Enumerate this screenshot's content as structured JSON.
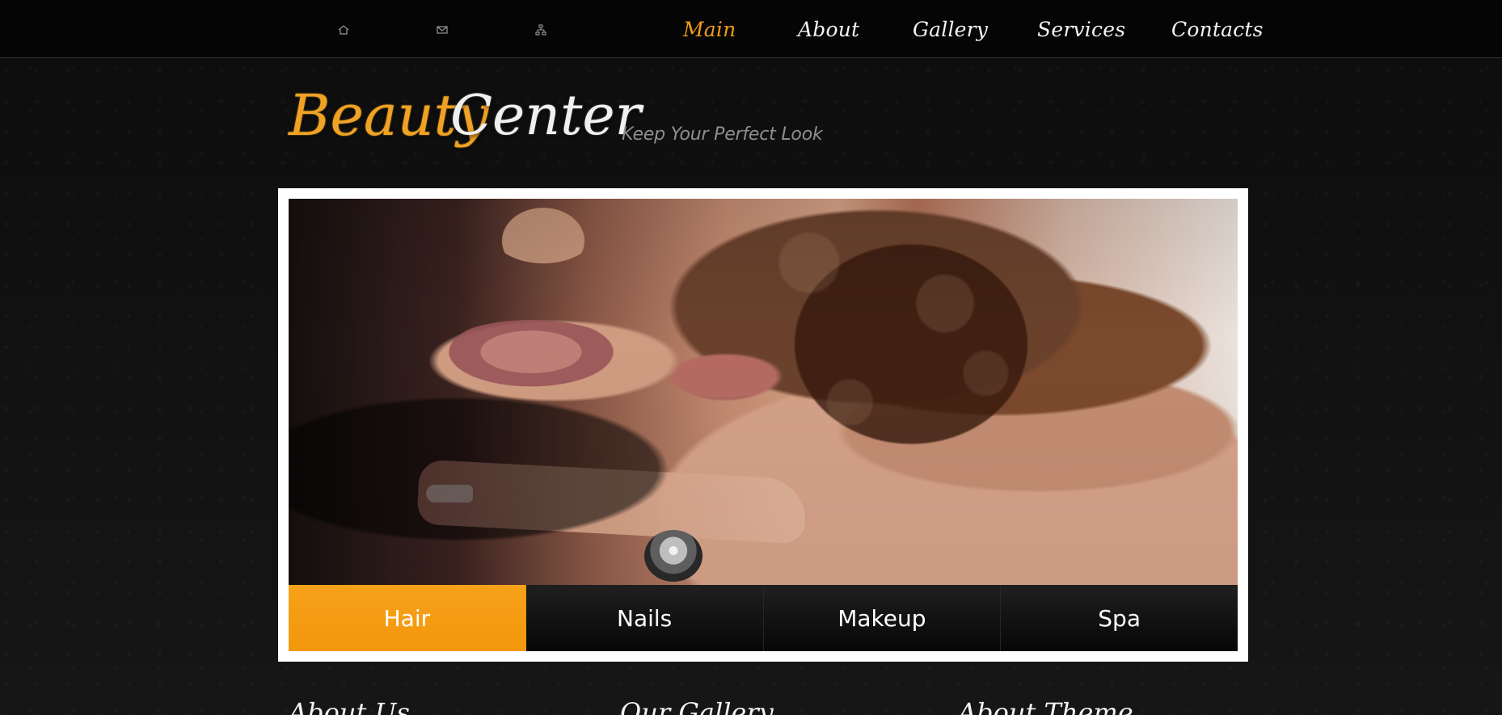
{
  "topbar": {
    "icons": [
      {
        "name": "home-icon"
      },
      {
        "name": "mail-icon"
      },
      {
        "name": "sitemap-icon"
      }
    ],
    "nav": [
      {
        "label": "Main",
        "active": true
      },
      {
        "label": "About",
        "active": false
      },
      {
        "label": "Gallery",
        "active": false
      },
      {
        "label": "Services",
        "active": false
      },
      {
        "label": "Contacts",
        "active": false
      }
    ]
  },
  "brand": {
    "primary": "Beauty",
    "secondary": "Center",
    "tagline": "Keep Your Perfect Look",
    "accent_color": "#f39b1a"
  },
  "hero": {
    "tabs": [
      {
        "label": "Hair",
        "active": true
      },
      {
        "label": "Nails",
        "active": false
      },
      {
        "label": "Makeup",
        "active": false
      },
      {
        "label": "Spa",
        "active": false
      }
    ]
  },
  "sections": {
    "labels": [
      "About Us",
      "Our Gallery",
      "About Theme"
    ]
  }
}
